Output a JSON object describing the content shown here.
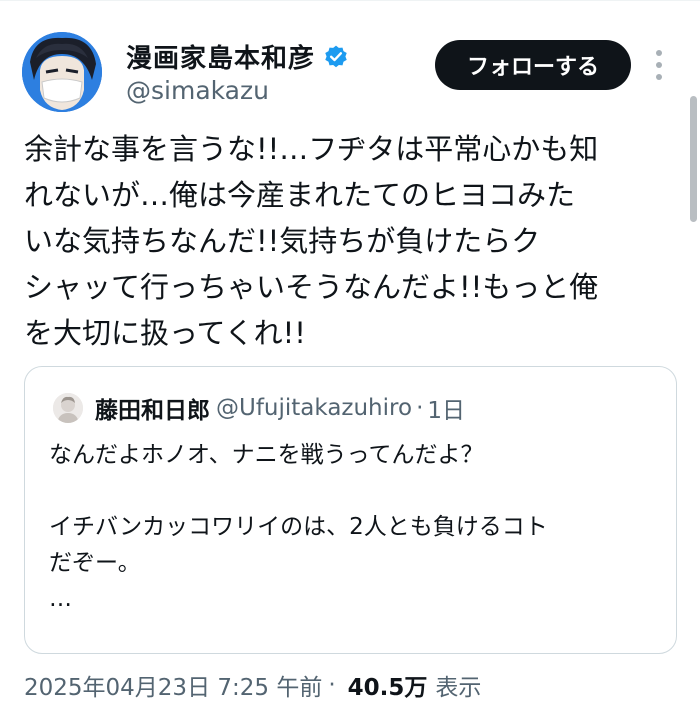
{
  "author": {
    "display_name": "漫画家島本和彦",
    "handle": "@simakazu",
    "verified": true
  },
  "follow_button": {
    "label": "フォローする"
  },
  "tweet": {
    "lines": [
      "余計な事を言うな!!…フヂタは平常心かも知",
      "れないが…俺は今産まれたてのヒヨコみた",
      "いな気持ちなんだ!!気持ちが負けたらク",
      "シャッて行っちゃいそうなんだよ!!もっと俺",
      "を大切に扱ってくれ!!"
    ]
  },
  "quote": {
    "display_name": "藤田和日郎",
    "handle": "@Ufujitakazuhiro",
    "separator": "·",
    "time": "1日",
    "lines": [
      "なんだよホノオ、ナニを戦うってんだよ？",
      "",
      "イチバンカッコワリイのは、2人とも負けるコト",
      "だぞー。",
      "…"
    ]
  },
  "meta": {
    "timestamp": "2025年04月23日 7:25 午前",
    "separator": "·",
    "views_count": "40.5万",
    "views_label": "表示"
  },
  "colors": {
    "text_primary": "#0f1419",
    "text_secondary": "#536471",
    "verified_blue": "#1d9bf0",
    "follow_bg": "#0f1419",
    "border": "#cfd9de"
  }
}
